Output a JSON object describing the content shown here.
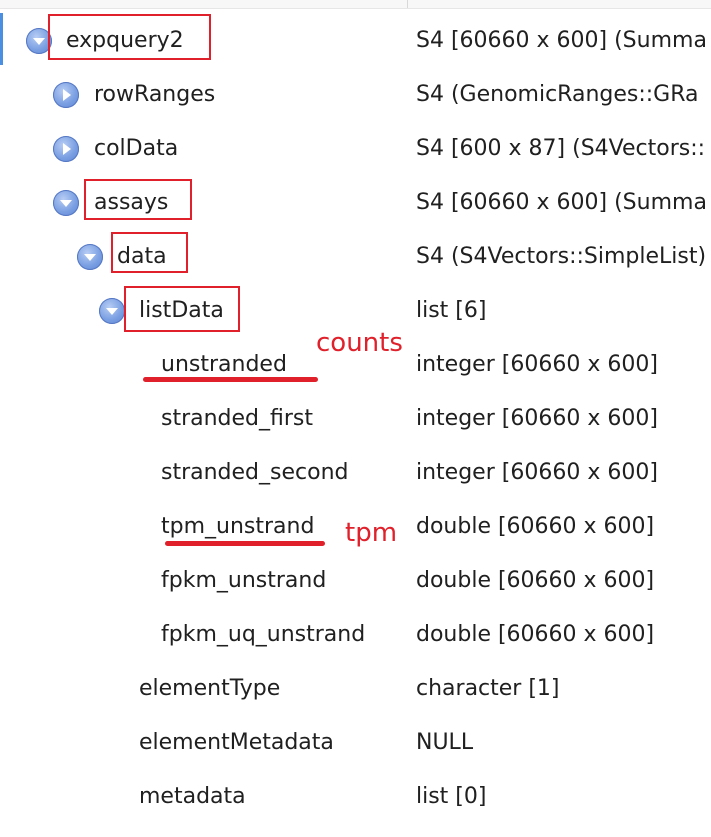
{
  "colors": {
    "highlight": "#e0202a",
    "twisty": "#6e93dd",
    "selection": "#4a8fe0"
  },
  "rows": [
    {
      "name": "expquery2",
      "value": "S4 [60660 x 600] (Summa",
      "expanded": true
    },
    {
      "name": "rowRanges",
      "value": "S4 (GenomicRanges::GRa",
      "expanded": false
    },
    {
      "name": "colData",
      "value": "S4 [600 x 87] (S4Vectors::",
      "expanded": false
    },
    {
      "name": "assays",
      "value": "S4 [60660 x 600] (Summa",
      "expanded": true
    },
    {
      "name": "data",
      "value": "S4 (S4Vectors::SimpleList)",
      "expanded": true
    },
    {
      "name": "listData",
      "value": "list [6]",
      "expanded": true
    },
    {
      "name": "unstranded",
      "value": "integer [60660 x 600]"
    },
    {
      "name": "stranded_first",
      "value": "integer [60660 x 600]"
    },
    {
      "name": "stranded_second",
      "value": "integer [60660 x 600]"
    },
    {
      "name": "tpm_unstrand",
      "value": "double [60660 x 600]"
    },
    {
      "name": "fpkm_unstrand",
      "value": "double [60660 x 600]"
    },
    {
      "name": "fpkm_uq_unstrand",
      "value": "double [60660 x 600]"
    },
    {
      "name": "elementType",
      "value": "character [1]"
    },
    {
      "name": "elementMetadata",
      "value": "NULL"
    },
    {
      "name": "metadata",
      "value": "list [0]"
    }
  ],
  "annotations": {
    "counts": "counts",
    "tpm": "tpm"
  }
}
